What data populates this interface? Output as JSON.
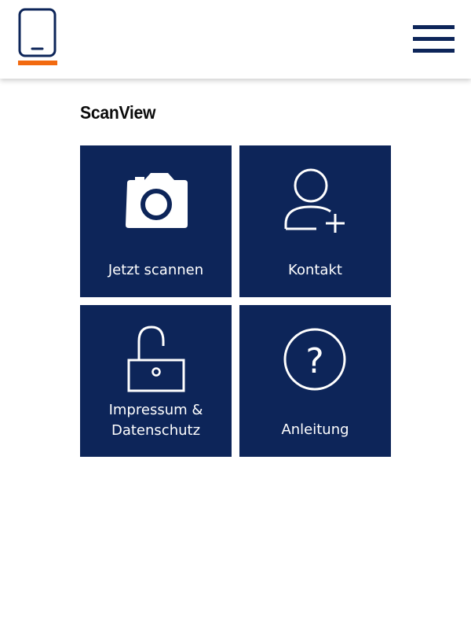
{
  "header": {
    "logo_icon": "tablet-icon",
    "menu_icon": "hamburger-menu-icon",
    "colors": {
      "logo_outline": "#0d2559",
      "logo_accent": "#f26a10"
    }
  },
  "page": {
    "title": "ScanView"
  },
  "tiles": [
    {
      "icon": "camera-icon",
      "label": "Jetzt scannen"
    },
    {
      "icon": "add-user-icon",
      "label": "Kontakt"
    },
    {
      "icon": "unlocked-padlock-icon",
      "label_line1": "Impressum &",
      "label_line2": "Datenschutz"
    },
    {
      "icon": "question-mark-circle-icon",
      "label": "Anleitung"
    }
  ],
  "colors": {
    "tile_background": "#0d2559",
    "tile_foreground": "#ffffff",
    "title_text": "#0b0b0b"
  }
}
